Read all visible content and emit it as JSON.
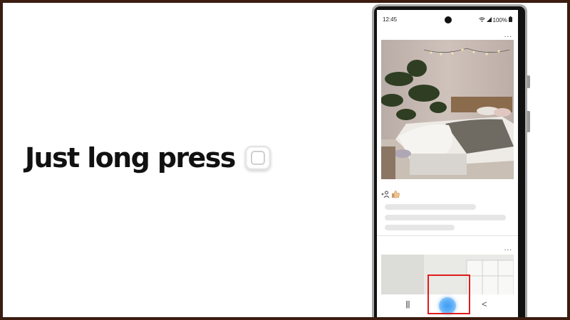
{
  "instruction": {
    "text": "Just long press",
    "key_icon": "home-key-icon"
  },
  "phone": {
    "status_bar": {
      "time": "12:45",
      "battery": "100%",
      "icons": [
        "wifi-icon",
        "signal-icon",
        "battery-icon"
      ]
    },
    "feed": {
      "post_menu": "...",
      "reaction_icons": [
        "add-friend-icon",
        "thumbs-up-icon"
      ]
    },
    "nav_bar": {
      "recent": "|||",
      "back": "<"
    }
  },
  "colors": {
    "highlight": "#e01b1b",
    "home_button": "#3f9df4",
    "border": "#3a1d10"
  }
}
